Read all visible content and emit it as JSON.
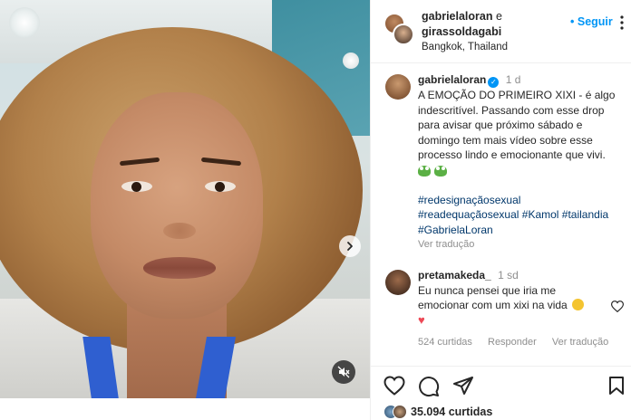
{
  "post_header": {
    "user1": "gabrielaloran",
    "conjunction": "e",
    "user2": "girassoldagabi",
    "location": "Bangkok, Thailand",
    "follow_label": "Seguir",
    "follow_separator": "•"
  },
  "caption": {
    "username": "gabrielaloran",
    "verified": true,
    "time": "1 d",
    "text": "A EMOÇÃO DO PRIMEIRO XIXI - é algo indescritível. Passando com esse drop para avisar que próximo sábado e domingo tem mais vídeo sobre esse processo lindo e emocionante que vivi.",
    "emojis": [
      "frog-emoji",
      "frog-emoji"
    ],
    "hashtags": [
      "#redesignaçãosexual",
      "#readequaçãosexual",
      "#Kamol",
      "#tailandia",
      "#GabrielaLoran"
    ],
    "see_translation": "Ver tradução"
  },
  "comment": {
    "username": "pretamakeda_",
    "time": "1 sd",
    "text": "Eu nunca pensei que iria me emocionar com um xixi na vida",
    "likes_label": "524 curtidas",
    "reply_label": "Responder",
    "translate_label": "Ver tradução"
  },
  "actions": {
    "likes_count": "35.094 curtidas"
  },
  "colors": {
    "accent": "#0095f6",
    "hashtag": "#00376b",
    "muted": "#8e8e8e",
    "heart": "#ed4956"
  }
}
